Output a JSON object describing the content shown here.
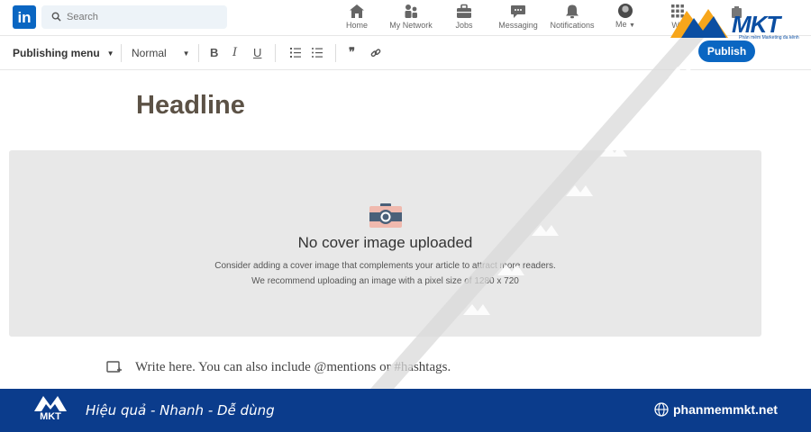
{
  "nav": {
    "logo_text": "in",
    "search_placeholder": "Search",
    "items": [
      {
        "label": "Home",
        "icon": "home-icon"
      },
      {
        "label": "My Network",
        "icon": "network-icon"
      },
      {
        "label": "Jobs",
        "icon": "briefcase-icon"
      },
      {
        "label": "Messaging",
        "icon": "chat-icon"
      },
      {
        "label": "Notifications",
        "icon": "bell-icon"
      },
      {
        "label": "Me",
        "icon": "avatar"
      },
      {
        "label": "Wo",
        "icon": "grid-icon"
      }
    ]
  },
  "toolbar": {
    "publishing_menu": "Publishing menu",
    "style_select": "Normal",
    "bold": "B",
    "italic": "I",
    "underline": "U",
    "quote": "❞",
    "publish_label": "Publish"
  },
  "editor": {
    "headline": "Headline",
    "cover_title": "No cover image uploaded",
    "cover_line_1": "Consider adding a cover image that complements your article to attract more readers.",
    "cover_line_2": "We recommend uploading an image with a pixel size of 1280 x 720",
    "body_placeholder": "Write here. You can also include @mentions or #hashtags."
  },
  "watermark": {
    "brand": "MKT",
    "tagline": "Phần mềm Marketing đa kênh",
    "slogan": "Hiệu quả - Nhanh - Dễ dùng",
    "website": "phanmemmkt.net",
    "logo_text": "MKT"
  },
  "colors": {
    "linkedin_blue": "#0a66c2",
    "footer_bg": "#0b3c8c",
    "mkt_blue": "#0b4ea2",
    "mkt_orange": "#f7a61b",
    "cover_bg": "#e8e8e8"
  }
}
